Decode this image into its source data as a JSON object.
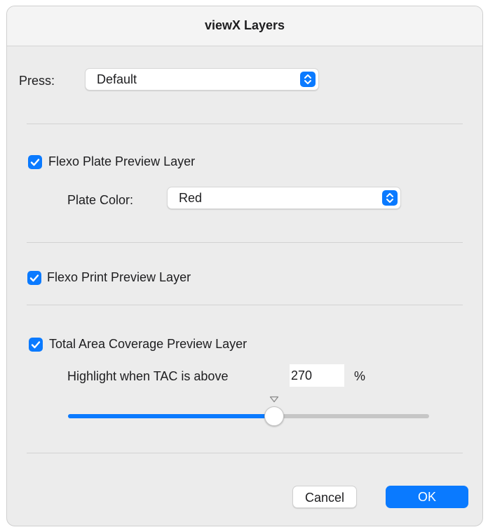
{
  "window": {
    "title": "viewX Layers"
  },
  "press": {
    "label": "Press:",
    "value": "Default"
  },
  "flexo_plate": {
    "checkbox_label": "Flexo Plate Preview Layer",
    "checked": true,
    "plate_color_label": "Plate Color:",
    "plate_color_value": "Red"
  },
  "flexo_print": {
    "checkbox_label": "Flexo Print Preview Layer",
    "checked": true
  },
  "tac": {
    "checkbox_label": "Total Area Coverage Preview Layer",
    "checked": true,
    "highlight_label": "Highlight when TAC is above",
    "value": "270",
    "unit": "%",
    "slider_fraction": 0.57
  },
  "buttons": {
    "cancel": "Cancel",
    "ok": "OK"
  },
  "colors": {
    "accent": "#0a7aff",
    "background": "#ececec"
  },
  "icons": {
    "popup_stepper": "up-down-chevron-icon",
    "checkbox": "checkmark-icon",
    "slider_tick": "triangle-down-icon"
  }
}
